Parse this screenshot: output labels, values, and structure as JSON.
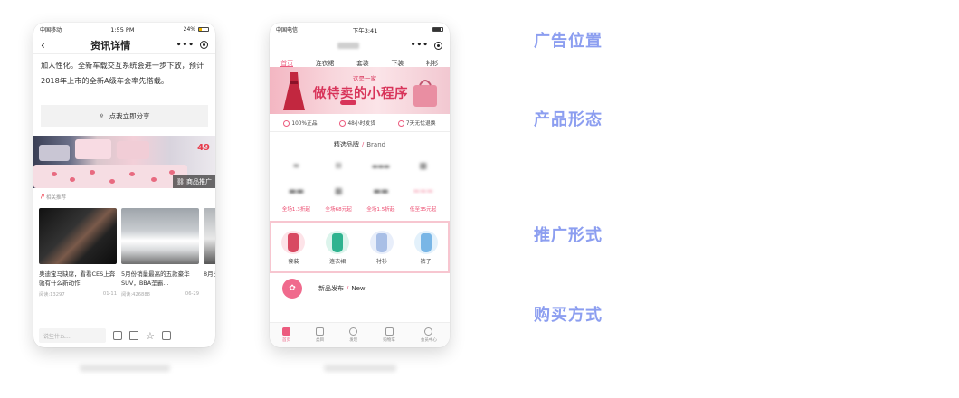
{
  "phone1": {
    "status": {
      "carrier": "中国移动",
      "time": "1:55 PM",
      "battery": "24%"
    },
    "nav": {
      "title": "资讯详情"
    },
    "article_text": "加人性化。全新车载交互系统会进一步下放，预计2018年上市的全新A级车会率先搭载。",
    "share_label": "点我立即分享",
    "banner": {
      "price": "49",
      "tag_label": "商品推广"
    },
    "related_title": "相关推荐",
    "cards": [
      {
        "title": "奥迪宝马缺席，看看CES上奔驰有什么新动作",
        "views": "阅读:13297",
        "date": "01-11"
      },
      {
        "title": "5月份销量最高的五款豪华SUV，BBA垄霸...",
        "views": "阅读:426888",
        "date": "06-29"
      },
      {
        "title": "8月出...",
        "views": "",
        "date": ""
      }
    ],
    "comment_placeholder": "说些什么..."
  },
  "phone2": {
    "status": {
      "carrier": "中国电信",
      "time": "下午3:41"
    },
    "tabs": [
      "首页",
      "连衣裙",
      "套装",
      "下装",
      "衬衫"
    ],
    "banner": {
      "sub": "这是一家",
      "main": "做特卖的小程序"
    },
    "benefits": [
      "100%正品",
      "48小时发货",
      "7天无忧退换"
    ],
    "brand_section": {
      "cn": "精选品牌",
      "en": "Brand"
    },
    "brands": [
      {
        "logo": "",
        "discount": "全场1.3折起"
      },
      {
        "logo": "",
        "discount": "全场68元起"
      },
      {
        "logo": "",
        "discount": "全场1.5折起"
      },
      {
        "logo": "",
        "discount": "低至35元起"
      }
    ],
    "categories": [
      {
        "label": "套装",
        "color": "#d84a62"
      },
      {
        "label": "连衣裙",
        "color": "#2fb38f"
      },
      {
        "label": "衬衫",
        "color": "#a9bfe6"
      },
      {
        "label": "裤子",
        "color": "#79b6e6"
      }
    ],
    "new_section": {
      "cn": "新品发布",
      "en": "New"
    },
    "tabbar": [
      "首页",
      "类目",
      "发现",
      "购物车",
      "会员中心"
    ]
  },
  "labels": [
    "广告位置",
    "产品形态",
    "推广形式",
    "购买方式"
  ],
  "colors": {
    "accent_pink": "#ec5b7e",
    "label_blue": "#8c9ef0"
  }
}
